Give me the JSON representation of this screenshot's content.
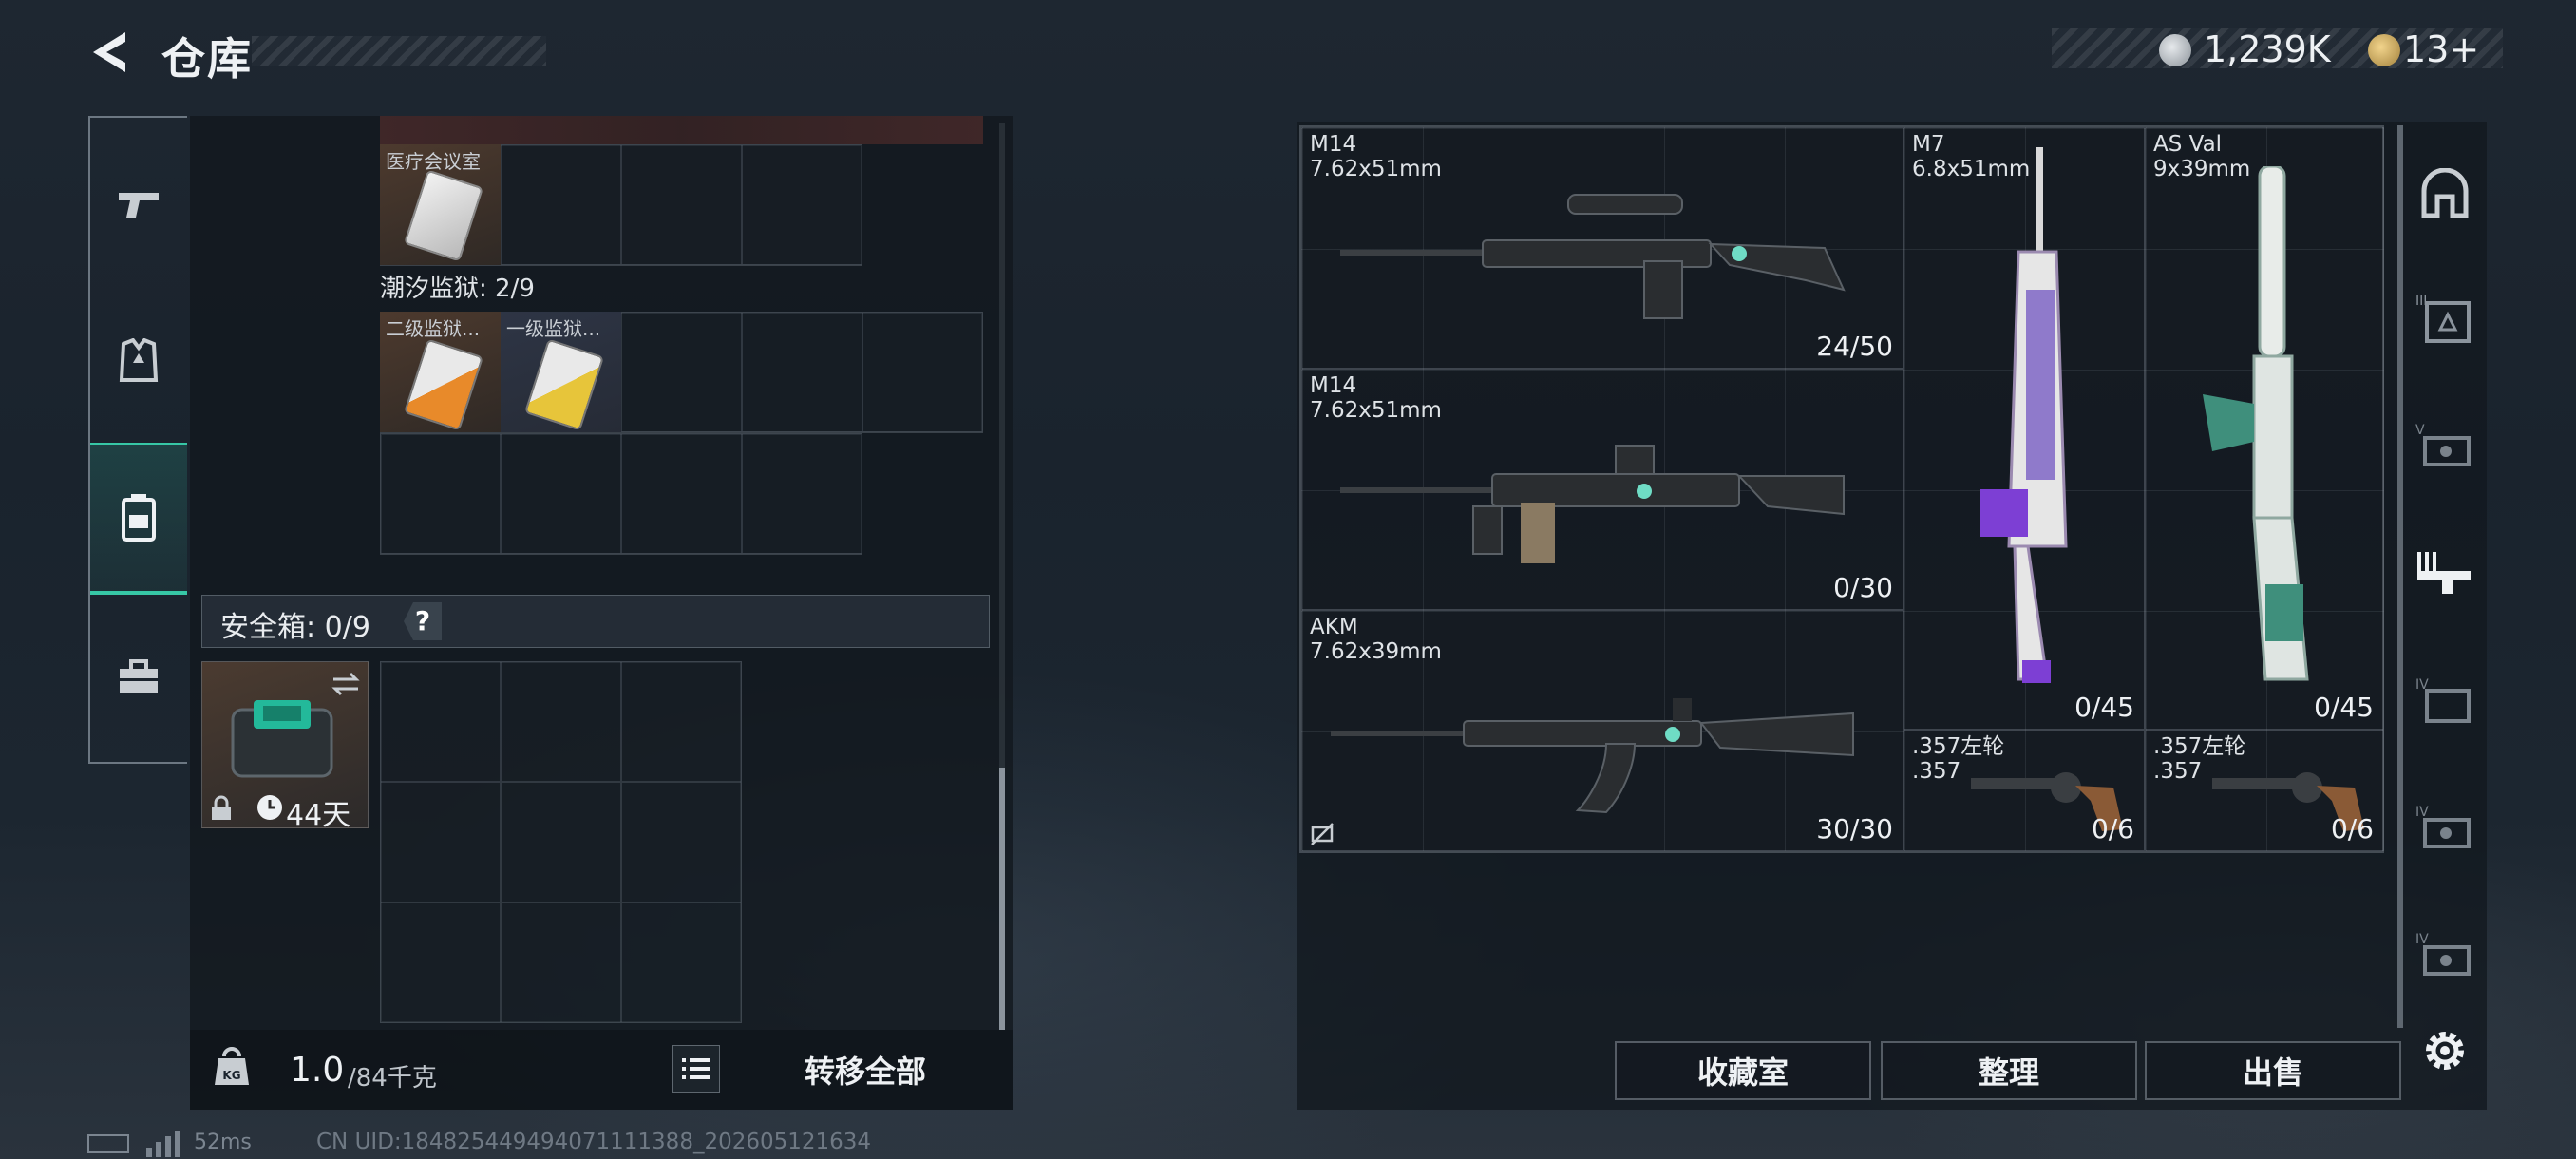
{
  "header": {
    "title": "仓库",
    "money": "1,239K",
    "tickets": "13+"
  },
  "left_nav": {
    "items": [
      {
        "name": "weapons"
      },
      {
        "name": "armor"
      },
      {
        "name": "backpack",
        "active": true
      },
      {
        "name": "toolbox"
      }
    ]
  },
  "storage": {
    "medical_item_label": "医疗会议室",
    "section_prison": "潮汐监狱: 2/9",
    "prison_items": [
      "二级监狱...",
      "一级监狱..."
    ],
    "safebox_label": "安全箱: 0/9",
    "safebox_help": "?",
    "safebox_timer": "44天"
  },
  "footer": {
    "weight_value": "1.0",
    "weight_capacity": "/84千克",
    "transfer_all": "转移全部",
    "status_ping": "52ms",
    "uid": "CN UID:184825449494071111388_202605121634"
  },
  "weapons": [
    {
      "name": "M14",
      "caliber": "7.62x51mm",
      "ammo": "24/50"
    },
    {
      "name": "M14",
      "caliber": "7.62x51mm",
      "ammo": "0/30"
    },
    {
      "name": "AKM",
      "caliber": "7.62x39mm",
      "ammo": "30/30"
    },
    {
      "name": "M7",
      "caliber": "6.8x51mm",
      "ammo": "0/45"
    },
    {
      "name": "AS Val",
      "caliber": "9x39mm",
      "ammo": "0/45"
    },
    {
      "name": ".357左轮",
      "caliber": ".357",
      "ammo": "0/6"
    },
    {
      "name": ".357左轮",
      "caliber": ".357",
      "ammo": "0/6"
    }
  ],
  "actions": {
    "collection": "收藏室",
    "organize": "整理",
    "sell": "出售"
  },
  "colors": {
    "accent": "#37c7a6",
    "background": "#1e2731"
  }
}
